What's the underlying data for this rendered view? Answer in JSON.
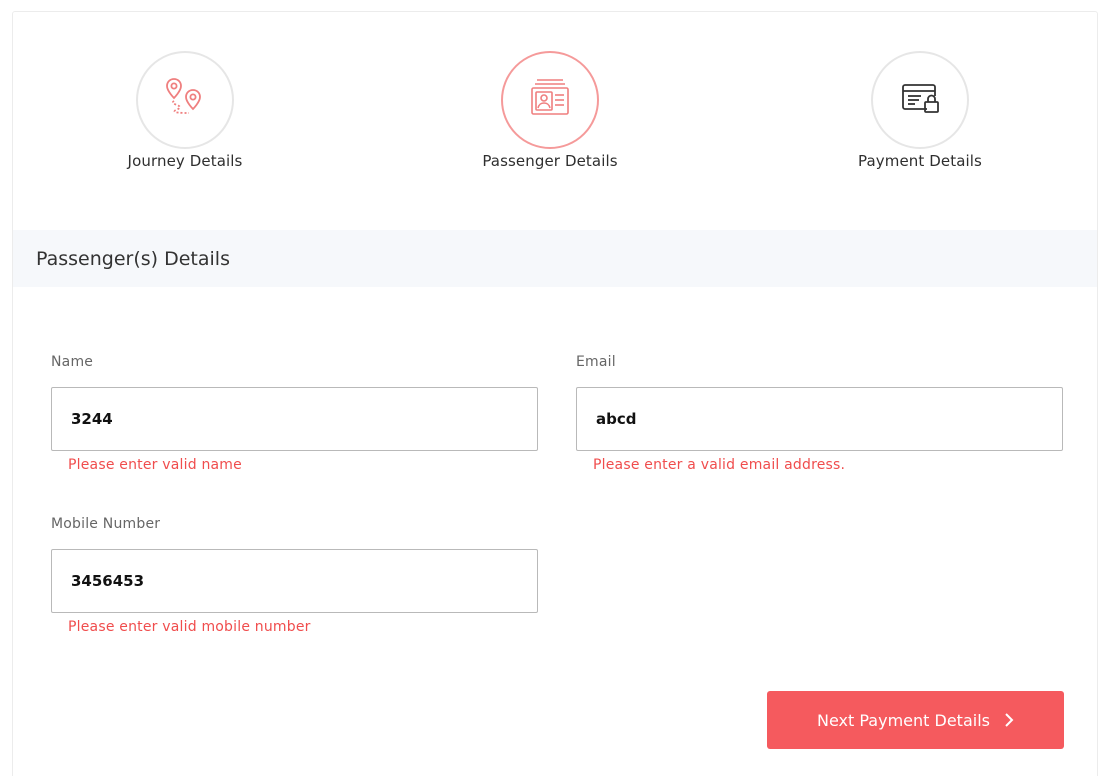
{
  "stepper": {
    "steps": [
      {
        "label": "Journey Details",
        "icon": "map-route-icon",
        "active": false
      },
      {
        "label": "Passenger Details",
        "icon": "id-card-icon",
        "active": true
      },
      {
        "label": "Payment Details",
        "icon": "secure-payment-icon",
        "active": false
      }
    ]
  },
  "section": {
    "title": "Passenger(s) Details"
  },
  "form": {
    "name": {
      "label": "Name",
      "value": "3244",
      "error": "Please enter valid name"
    },
    "email": {
      "label": "Email",
      "value": "abcd",
      "error": "Please enter a valid email address."
    },
    "mobile": {
      "label": "Mobile Number",
      "value": "3456453",
      "error": "Please enter valid mobile number"
    }
  },
  "actions": {
    "next_label": "Next Payment Details",
    "next_icon": "chevron-right-icon"
  },
  "colors": {
    "accent": "#f55a5e",
    "error": "#f04d4d",
    "active_step_border": "#f59a9a",
    "section_bg": "#f6f8fb"
  }
}
